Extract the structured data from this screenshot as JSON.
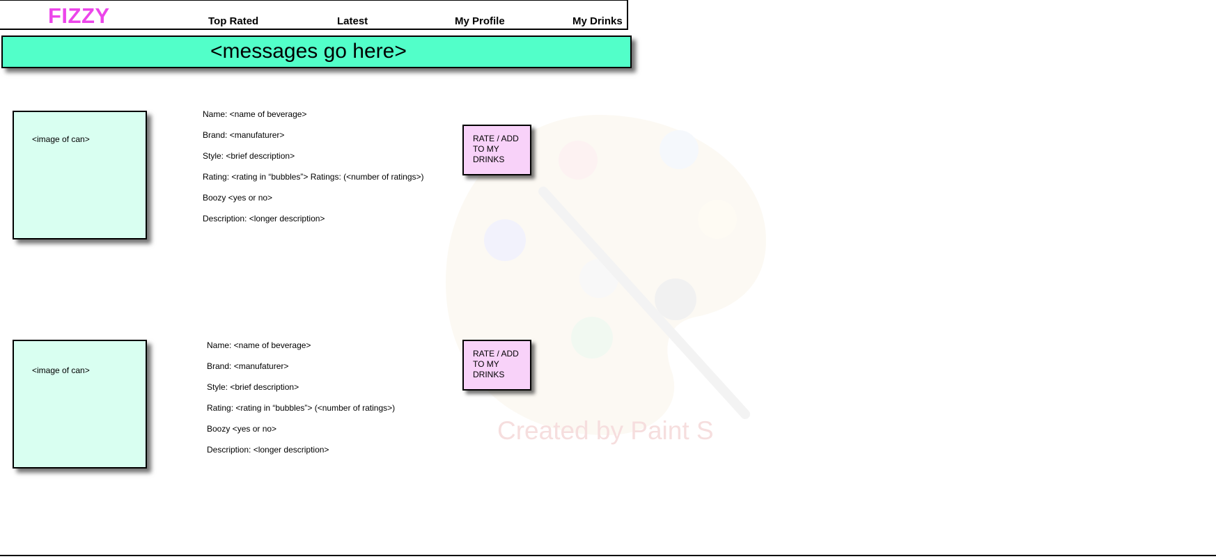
{
  "header": {
    "logo": "FIZZY",
    "nav": [
      "Top Rated",
      "Latest",
      "My Profile",
      "My Drinks"
    ]
  },
  "banner": {
    "text": "<messages go here>"
  },
  "watermark": {
    "text": "Created by Paint S"
  },
  "cards": [
    {
      "image_label": "<image of can>",
      "fields": [
        "Name: <name of beverage>",
        "Brand: <manufaturer>",
        "Style: <brief description>",
        "Rating: <rating in “bubbles”> Ratings: (<number of ratings>)",
        "Boozy <yes or no>",
        "Description: <longer description>"
      ],
      "button": "RATE / ADD TO MY DRINKS"
    },
    {
      "image_label": "<image of can>",
      "fields": [
        "Name: <name of beverage>",
        "Brand: <manufaturer>",
        "Style: <brief description>",
        "Rating: <rating in “bubbles”> (<number of ratings>)",
        "Boozy <yes or no>",
        "Description: <longer description>"
      ],
      "button": "RATE / ADD TO MY DRINKS"
    }
  ],
  "colors": {
    "logo": "#ec45ea",
    "banner": "#52ffc9",
    "can_box": "#d9fff1",
    "button": "#f8d2f9"
  }
}
